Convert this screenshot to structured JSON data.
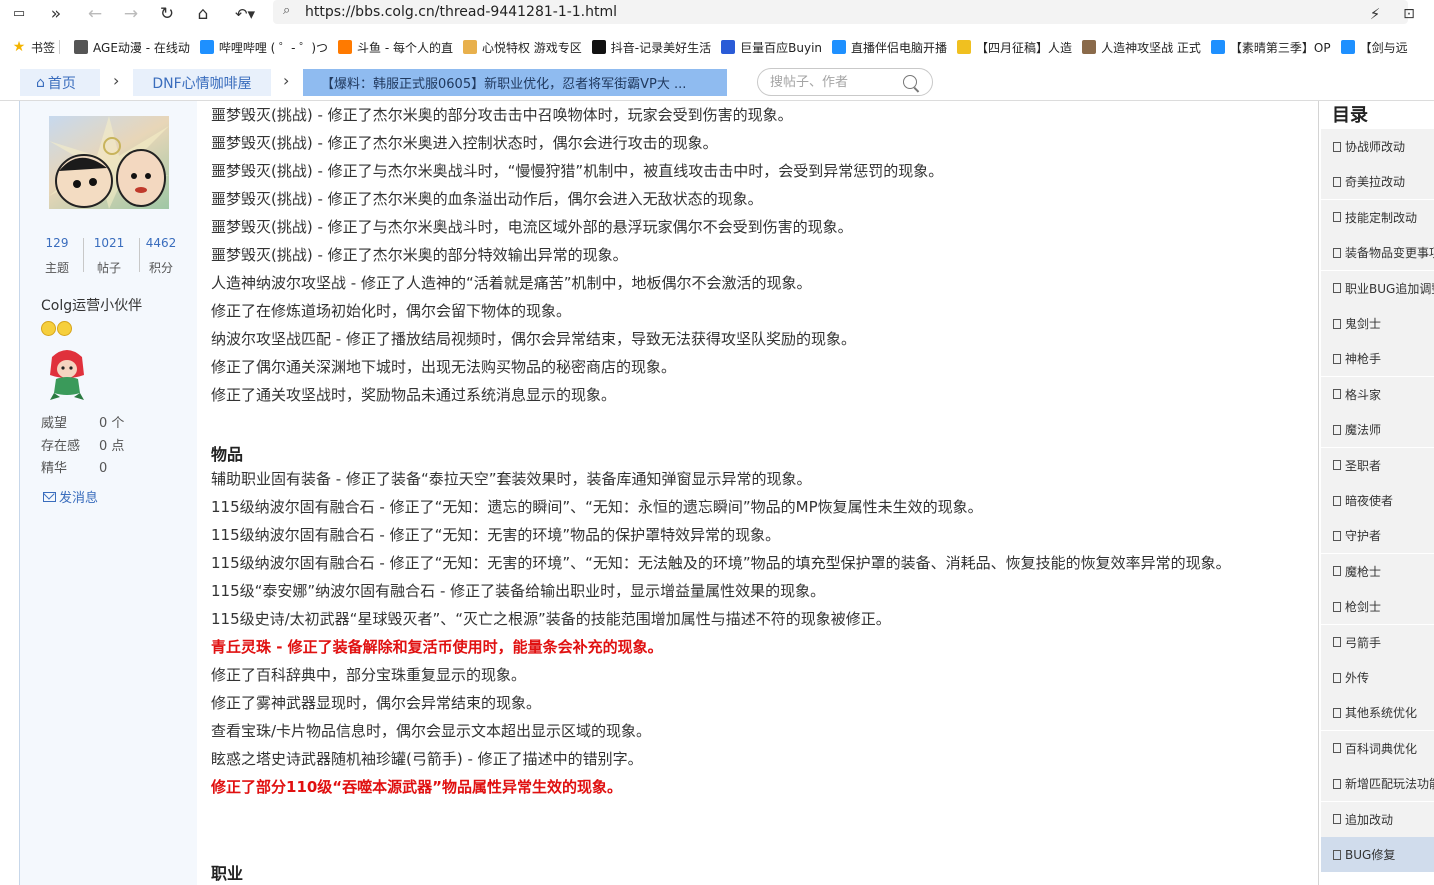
{
  "browser": {
    "url": "https://bbs.colg.cn/thread-9441281-1-1.html",
    "bookmarks": [
      {
        "label": "书签",
        "icon": "star-icon",
        "color": "#f4b400"
      },
      {
        "label": "AGE动漫 - 在线动",
        "icon": "site-icon",
        "color": "#555555"
      },
      {
        "label": "哔哩哔哩 ( ゜- ゜)つ",
        "icon": "bilibili-icon",
        "color": "#1e90ff"
      },
      {
        "label": "斗鱼 - 每个人的直",
        "icon": "douyu-icon",
        "color": "#ff7a00"
      },
      {
        "label": "心悦特权 游戏专区",
        "icon": "heart-icon",
        "color": "#e8b04c"
      },
      {
        "label": "抖音-记录美好生活",
        "icon": "douyin-icon",
        "color": "#111111"
      },
      {
        "label": "巨量百应Buyin",
        "icon": "buyin-icon",
        "color": "#2a5bd7"
      },
      {
        "label": "直播伴侣电脑开播",
        "icon": "bilibili-icon",
        "color": "#1e90ff"
      },
      {
        "label": "【四月征稿】人造",
        "icon": "ribbon-icon",
        "color": "#f0c020"
      },
      {
        "label": "人造神攻坚战 正式",
        "icon": "game-icon",
        "color": "#8a6a4a"
      },
      {
        "label": "【素晴第三季】OP",
        "icon": "bilibili-icon",
        "color": "#1e90ff"
      },
      {
        "label": "【剑与远",
        "icon": "bilibili-icon",
        "color": "#1e90ff"
      }
    ]
  },
  "breadcrumb": {
    "home": "首页",
    "board": "DNF心情咖啡屋",
    "thread": "【爆料：韩服正式服0605】新职业优化，忍者将军街霸VP大 ..."
  },
  "search": {
    "placeholder": "搜帖子、作者"
  },
  "profile": {
    "stats": [
      {
        "value": "129",
        "label": "主题"
      },
      {
        "value": "1021",
        "label": "帖子"
      },
      {
        "value": "4462",
        "label": "积分"
      }
    ],
    "group": "Colg运营小伙伴",
    "fields": [
      {
        "key": "威望",
        "value": "0 个"
      },
      {
        "key": "存在感",
        "value": "0 点"
      },
      {
        "key": "精华",
        "value": "0"
      }
    ],
    "send_message": "发消息"
  },
  "post": {
    "lines_top": [
      "噩梦毁灭(挑战) - 修正了杰尔米奥的部分攻击击中召唤物体时，玩家会受到伤害的现象。",
      "噩梦毁灭(挑战) - 修正了杰尔米奥进入控制状态时，偶尔会进行攻击的现象。",
      "噩梦毁灭(挑战) - 修正了与杰尔米奥战斗时，“慢慢狩猎”机制中，被直线攻击击中时，会受到异常惩罚的现象。",
      "噩梦毁灭(挑战) - 修正了杰尔米奥的血条溢出动作后，偶尔会进入无敌状态的现象。",
      "噩梦毁灭(挑战) - 修正了与杰尔米奥战斗时，电流区域外部的悬浮玩家偶尔不会受到伤害的现象。",
      "噩梦毁灭(挑战) - 修正了杰尔米奥的部分特效输出异常的现象。",
      "人造神纳波尔攻坚战 - 修正了人造神的“活着就是痛苦”机制中，地板偶尔不会激活的现象。",
      "修正了在修炼道场初始化时，偶尔会留下物体的现象。",
      "纳波尔攻坚战匹配 - 修正了播放结局视频时，偶尔会异常结束，导致无法获得攻坚队奖励的现象。",
      "修正了偶尔通关深渊地下城时，出现无法购买物品的秘密商店的现象。",
      "修正了通关攻坚战时，奖励物品未通过系统消息显示的现象。"
    ],
    "section_items": "物品",
    "lines_items": [
      {
        "text": "辅助职业固有装备 - 修正了装备“泰拉天空”套装效果时，装备库通知弹窗显示异常的现象。",
        "red": false
      },
      {
        "text": "115级纳波尔固有融合石 - 修正了“无知：遗忘的瞬间”、“无知：永恒的遗忘瞬间”物品的MP恢复属性未生效的现象。",
        "red": false
      },
      {
        "text": "115级纳波尔固有融合石 - 修正了“无知：无害的环境”物品的保护罩特效异常的现象。",
        "red": false
      },
      {
        "text": "115级纳波尔固有融合石 - 修正了“无知：无害的环境”、“无知：无法触及的环境”物品的填充型保护罩的装备、消耗品、恢复技能的恢复效率异常的现象。",
        "red": false
      },
      {
        "text": "115级“泰安娜”纳波尔固有融合石 - 修正了装备给输出职业时，显示增益量属性效果的现象。",
        "red": false
      },
      {
        "text": "115级史诗/太初武器“星球毁灭者”、“灭亡之根源”装备的技能范围增加属性与描述不符的现象被修正。",
        "red": false
      },
      {
        "text": "青丘灵珠 - 修正了装备解除和复活币使用时，能量条会补充的现象。",
        "red": true
      },
      {
        "text": "修正了百科辞典中，部分宝珠重复显示的现象。",
        "red": false
      },
      {
        "text": "修正了雾神武器显现时，偶尔会异常结束的现象。",
        "red": false
      },
      {
        "text": "查看宝珠/卡片物品信息时，偶尔会显示文本超出显示区域的现象。",
        "red": false
      },
      {
        "text": "眩惑之塔史诗武器随机袖珍罐(弓箭手) - 修正了描述中的错别字。",
        "red": false
      },
      {
        "text": "修正了部分110级“吞噬本源武器”物品属性异常生效的现象。",
        "red": true
      }
    ],
    "section_jobs": "职业"
  },
  "toc": {
    "title": "目录",
    "items": [
      "协战师改动",
      "奇美拉改动",
      "技能定制改动",
      "装备物品变更事项",
      "职业BUG追加调整",
      "鬼剑士",
      "神枪手",
      "格斗家",
      "魔法师",
      "圣职者",
      "暗夜使者",
      "守护者",
      "魔枪士",
      "枪剑士",
      "弓箭手",
      "外传",
      "其他系统优化",
      "百科词典优化",
      "新增匹配玩法功能",
      "追加改动",
      "BUG修复"
    ],
    "active_index": 20
  }
}
